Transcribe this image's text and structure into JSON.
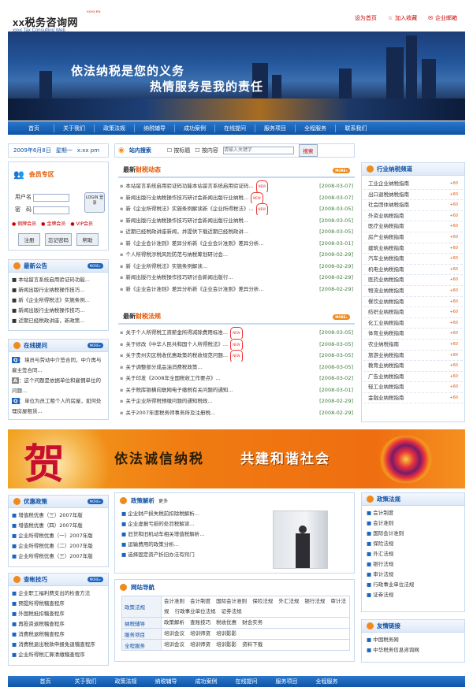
{
  "site": {
    "logo": "xx税务咨询网",
    "logo_en": "xxxx Tax Consulting Web",
    "logo_mark": "XXXX.EN"
  },
  "toplinks": [
    "设为首页",
    "加入收藏",
    "企业邮箱"
  ],
  "hero": {
    "line1": "依法纳税是您的义务",
    "line2": "热情服务是我的责任"
  },
  "nav": [
    "首页",
    "关于我们",
    "政策法规",
    "纳税辅导",
    "成功案例",
    "在线提问",
    "服务项目",
    "全程服务",
    "联系我们"
  ],
  "infobar": {
    "date": "2009年6月8日",
    "week": "星期一",
    "time": "x:xx pm"
  },
  "search": {
    "label": "站内搜索",
    "opt1": "按标题",
    "opt2": "按内容",
    "placeholder": "请输入关键字",
    "button": "搜索"
  },
  "member": {
    "title": "会员专区",
    "user": "用户名",
    "pass": "密　码",
    "login": "LOGIN 登录",
    "levels": [
      "钢牌会员",
      "金牌会员",
      "VIP会员"
    ],
    "buttons": [
      "注册",
      "忘记密码",
      "帮助"
    ]
  },
  "notice": {
    "title": "最新公告",
    "items": [
      "本站留言系统启用验证码功能...",
      "新闻出版行业纳税操作技巧...",
      "新《企业所得税法》实施条例...",
      "新闻出版行业纳税操作技巧...",
      "近期已经税政讲座，新政策..."
    ]
  },
  "qa": {
    "title": "在线提问",
    "items": [
      {
        "tag": "Q",
        "text": "：境员与劳动中介签合同，中介再与雇主签合同..."
      },
      {
        "tag": "A",
        "text": "：这个问题是依据单位和雇佣单位的问题..."
      },
      {
        "tag": "Q",
        "text": "：单位为员工租个人的房屋，如何处理房屋租赁..."
      }
    ]
  },
  "news": {
    "title_a": "最新",
    "title_b": "财税动态",
    "items": [
      {
        "t": "本站留言系统启用验证码功能本站留言系统启用验证码...",
        "d": "[2008-03-07]",
        "n": true
      },
      {
        "t": "新闻出版行业纳税操作技巧研讨会新闻出版行业纳税...",
        "d": "[2008-03-07]",
        "n": true
      },
      {
        "t": "新《企业所得税法》实施条例解读新《企业所得税法》...",
        "d": "[2008-03-05]",
        "n": true
      },
      {
        "t": "新闻出版行业纳税操作技巧研讨会新闻出版行业纳税...",
        "d": "[2008-03-05]",
        "n": false
      },
      {
        "t": "近期已经税政讲座新闻，并提供下载近期已经税政讲...",
        "d": "[2008-03-05]",
        "n": false
      },
      {
        "t": "新《企业会计准则》差异分析新《企业会计准则》差异分析...",
        "d": "[2008-03-01]",
        "n": false
      },
      {
        "t": "个人所得税涉税风险防范与纳税筹划研讨会...",
        "d": "[2008-02-29]",
        "n": false
      },
      {
        "t": "新《企业所得税法》实施条例解读...",
        "d": "[2008-02-29]",
        "n": false
      },
      {
        "t": "新闻出版行业纳税操作技巧研讨会新闻出版行...",
        "d": "[2008-02-29]",
        "n": false
      },
      {
        "t": "新《企业会计准则》差异分析新《企业会计准则》差异分析...",
        "d": "[2008-02-29]",
        "n": false
      }
    ]
  },
  "laws": {
    "title_a": "最新",
    "title_b": "财税法规",
    "items": [
      {
        "t": "关于个人所得税工资薪金所得减除费用标准...",
        "d": "[2008-03-05]",
        "n": true
      },
      {
        "t": "关于修改《中华人民共和国个人所得税法》...",
        "d": "[2008-03-05]",
        "n": true
      },
      {
        "t": "关于贵州灾区税收优惠政策的税收规范问题...",
        "d": "[2008-03-05]",
        "n": true
      },
      {
        "t": "关于调整部分成品油消费税政策...",
        "d": "[2008-03-05]",
        "n": false
      },
      {
        "t": "关于印发《2008年全国税收工作要点》...",
        "d": "[2008-03-02]",
        "n": false
      },
      {
        "t": "关于税库银横向联网电子缴税有关问题的通知...",
        "d": "[2008-03-01]",
        "n": false
      },
      {
        "t": "关于企业所得税预缴问题的通知税政...",
        "d": "[2008-02-29]",
        "n": false
      },
      {
        "t": "关于2007年度税务师事务所及注册税...",
        "d": "[2008-02-29]",
        "n": false
      }
    ]
  },
  "trade": {
    "title": "行业纳税频道",
    "items": [
      "工业企业纳税指南",
      "出口退税纳税指南",
      "社会团体纳税指南",
      "外资业纳税指南",
      "医疗业纳税指南",
      "房产业纳税指南",
      "建筑业纳税指南",
      "汽车业纳税指南",
      "机电业纳税指南",
      "医药业纳税指南",
      "物流业纳税指南",
      "餐饮业纳税指南",
      "纺织业纳税指南",
      "化工业纳税指南",
      "体育业纳税指南",
      "农业纳税指南",
      "旅游业纳税指南",
      "教育业纳税指南",
      "广告业纳税指南",
      "轻工业纳税指南",
      "金融业纳税指南"
    ],
    "more": "+60"
  },
  "banner": {
    "char": "贺",
    "text1": "依法诚信纳税",
    "text2": "共建和谐社会"
  },
  "pref": {
    "title": "优惠政策",
    "items": [
      "增值税优惠（三）2007年版",
      "增值税优惠（四）2007年版",
      "企业所得税优惠（一）2007年版",
      "企业所得税优惠（二）2007年版",
      "企业所得税优惠（三）2007年版"
    ]
  },
  "tips": {
    "title": "查帐技巧",
    "items": [
      "企业职工福利费支出的检查方法",
      "预提所得税稽查程序",
      "外国税抵扣稽查程序",
      "再投资退税稽查程序",
      "消费税退税稽查程序",
      "消费税退出税款申报免退稽查程序",
      "企业所得税汇算清缴稽查程序"
    ]
  },
  "analysis": {
    "title": "政策解析",
    "more": "更多",
    "items": [
      "企业财产损失税前扣除税解析...",
      "企业虚报亏损的处罚税解读...",
      "旧货和旧机动车相关增值税解析...",
      "运输费用的政策分析...",
      "选择固定资产折旧办法有窍门"
    ]
  },
  "sitenav": {
    "title": "网站导航",
    "rows": [
      {
        "h": "政策法规",
        "c": [
          "会计准则",
          "会计制度",
          "国际会计准则",
          "保险法规",
          "外汇法规",
          "银行法规",
          "审计法规",
          "行政事业单位法规",
          "证券法规"
        ]
      },
      {
        "h": "纳税辅导",
        "c": [
          "政策解析",
          "查账技巧",
          "税收优惠",
          "财会实务"
        ]
      },
      {
        "h": "服务项目",
        "c": [
          "培训会议",
          "培训师资",
          "培训影影"
        ]
      },
      {
        "h": "全程服务",
        "c": [
          "培训会议",
          "培训师资",
          "培训影影",
          "资料下载"
        ]
      }
    ]
  },
  "policy": {
    "title": "政策法规",
    "items": [
      "会计制度",
      "会计准则",
      "国际会计准则",
      "保险法规",
      "外汇法规",
      "银行法规",
      "审计法规",
      "行政事业单位法规",
      "证券法规"
    ]
  },
  "links": {
    "title": "友情链接",
    "items": [
      "中国税务网",
      "中华税务信息咨询网"
    ]
  },
  "footer": [
    "首页",
    "关于我们",
    "政策法规",
    "纳税辅导",
    "成功案例",
    "在线提问",
    "服务项目",
    "全程服务"
  ],
  "colors": {
    "accent": "#0d4fa3",
    "nav": "#1a64c0",
    "orange": "#f07b12"
  }
}
